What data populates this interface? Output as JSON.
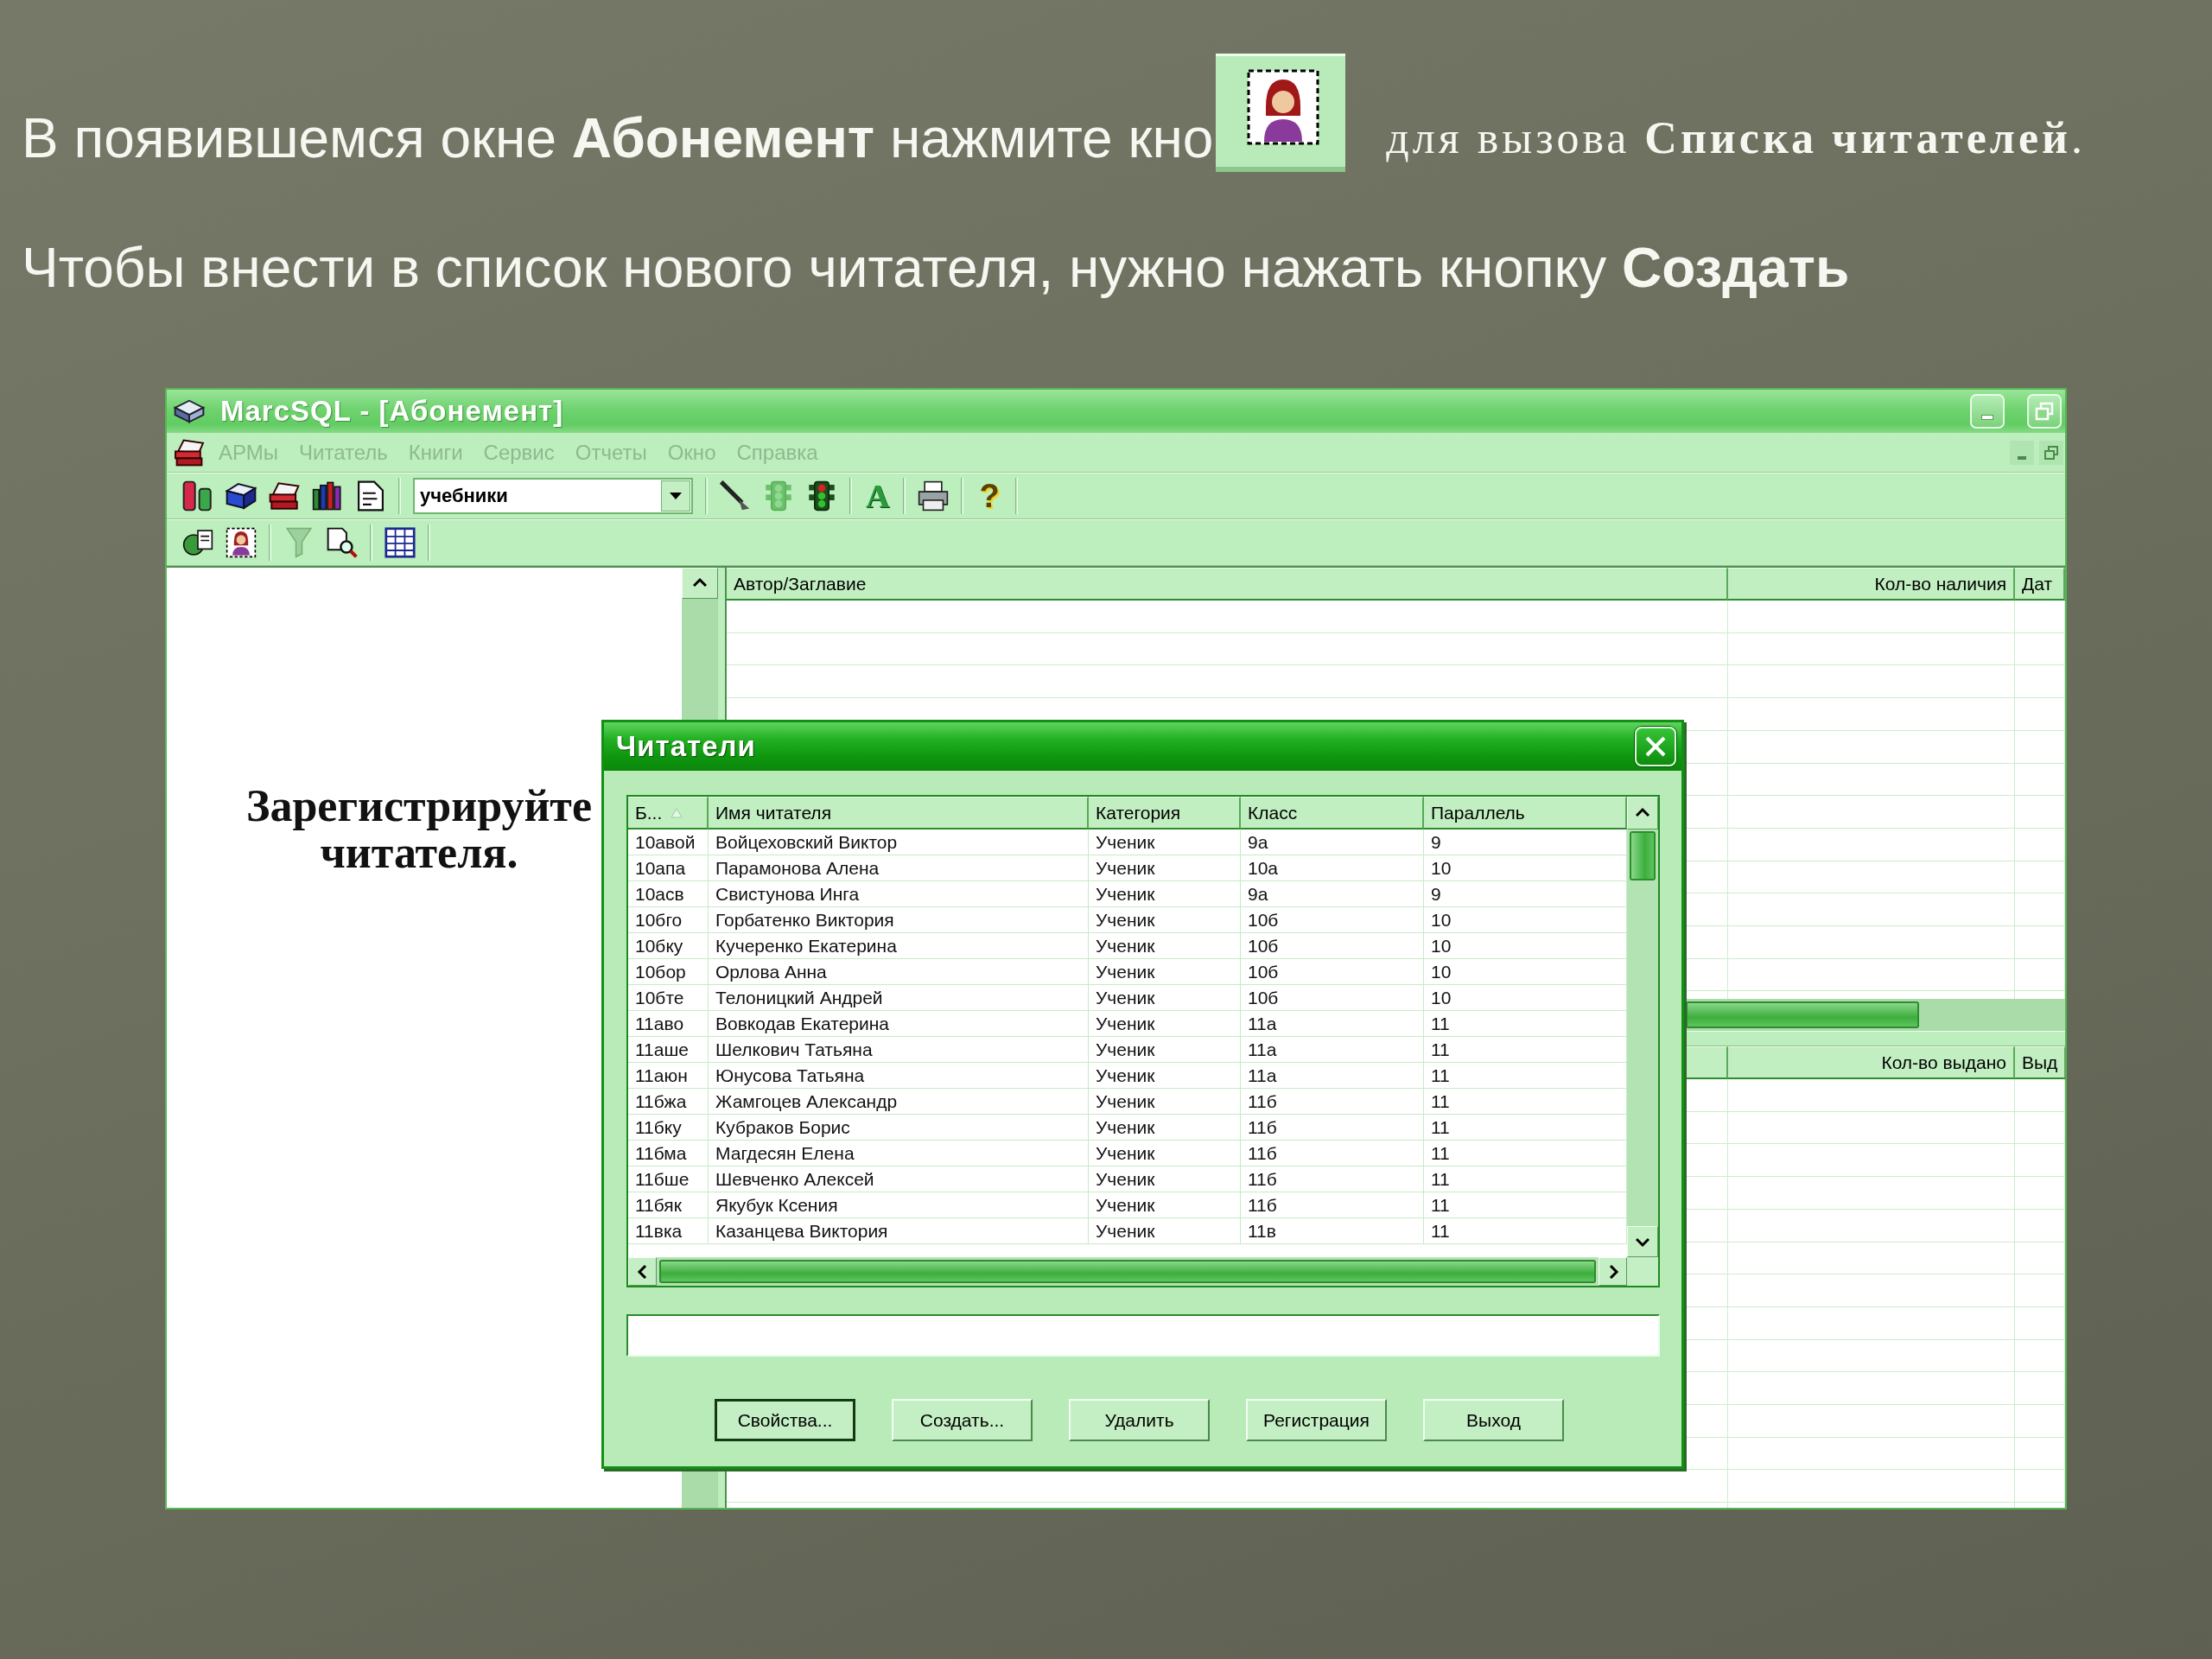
{
  "slide": {
    "line_1": {
      "before": "В появившемся окне **Абонемент** нажмите кно",
      "after": "для вызова **Списка читателей**."
    },
    "line_2": "Чтобы внести в список нового читателя, нужно нажать кнопку **Создать**"
  },
  "window": {
    "title": "MarcSQL - [Абонемент]",
    "menu": [
      {
        "label": "АРМы",
        "disabled": true
      },
      {
        "label": "Читатель",
        "disabled": true
      },
      {
        "label": "Книги",
        "disabled": true
      },
      {
        "label": "Сервис",
        "disabled": true
      },
      {
        "label": "Отчеты",
        "disabled": true
      },
      {
        "label": "Окно",
        "disabled": true
      },
      {
        "label": "Справка",
        "disabled": true
      }
    ],
    "toolbar": {
      "combo_value": "учебники",
      "font_glyph": "A",
      "help_glyph": "?"
    },
    "left_pane": {
      "message": "Зарегистрируйте читателя."
    },
    "top_grid": {
      "columns": [
        {
          "label": "Автор/Заглавие",
          "kind": "text"
        },
        {
          "label": "Кол-во наличия",
          "kind": "number"
        },
        {
          "label": "Дат",
          "kind": "text"
        }
      ]
    },
    "bottom_grid": {
      "columns": [
        {
          "label": "Кол-во выдано",
          "kind": "number"
        },
        {
          "label": "Выд",
          "kind": "text"
        }
      ]
    }
  },
  "dialog": {
    "title": "Читатели",
    "table": {
      "columns": [
        {
          "label": "Б...",
          "sorted": true
        },
        {
          "label": "Имя читателя",
          "sorted": false
        },
        {
          "label": "Категория",
          "sorted": false
        },
        {
          "label": "Класс",
          "sorted": false
        },
        {
          "label": "Параллель",
          "sorted": false
        }
      ],
      "rows": [
        [
          "10авой",
          "Войцеховский Виктор",
          "Ученик",
          "9а",
          "9"
        ],
        [
          "10апа",
          "Парамонова Алена",
          "Ученик",
          "10а",
          "10"
        ],
        [
          "10асв",
          "Свистунова Инга",
          "Ученик",
          "9а",
          "9"
        ],
        [
          "10бго",
          "Горбатенко Виктория",
          "Ученик",
          "10б",
          "10"
        ],
        [
          "10бку",
          "Кучеренко Екатерина",
          "Ученик",
          "10б",
          "10"
        ],
        [
          "10бор",
          "Орлова Анна",
          "Ученик",
          "10б",
          "10"
        ],
        [
          "10бте",
          "Телоницкий Андрей",
          "Ученик",
          "10б",
          "10"
        ],
        [
          "11аво",
          "Вовкодав Екатерина",
          "Ученик",
          "11а",
          "11"
        ],
        [
          "11аше",
          "Шелкович Татьяна",
          "Ученик",
          "11а",
          "11"
        ],
        [
          "11аюн",
          "Юнусова Татьяна",
          "Ученик",
          "11а",
          "11"
        ],
        [
          "11бжа",
          "Жамгоцев Александр",
          "Ученик",
          "11б",
          "11"
        ],
        [
          "11бку",
          "Кубраков Борис",
          "Ученик",
          "11б",
          "11"
        ],
        [
          "11бма",
          "Магдесян Елена",
          "Ученик",
          "11б",
          "11"
        ],
        [
          "11бше",
          "Шевченко Алексей",
          "Ученик",
          "11б",
          "11"
        ],
        [
          "11бяк",
          "Якубук Ксения",
          "Ученик",
          "11б",
          "11"
        ],
        [
          "11вка",
          "Казанцева Виктория",
          "Ученик",
          "11в",
          "11"
        ]
      ]
    },
    "buttons": [
      {
        "label": "Свойства...",
        "default": true
      },
      {
        "label": "Создать...",
        "default": false
      },
      {
        "label": "Удалить",
        "default": false
      },
      {
        "label": "Регистрация",
        "default": false
      },
      {
        "label": "Выход",
        "default": false
      }
    ]
  }
}
